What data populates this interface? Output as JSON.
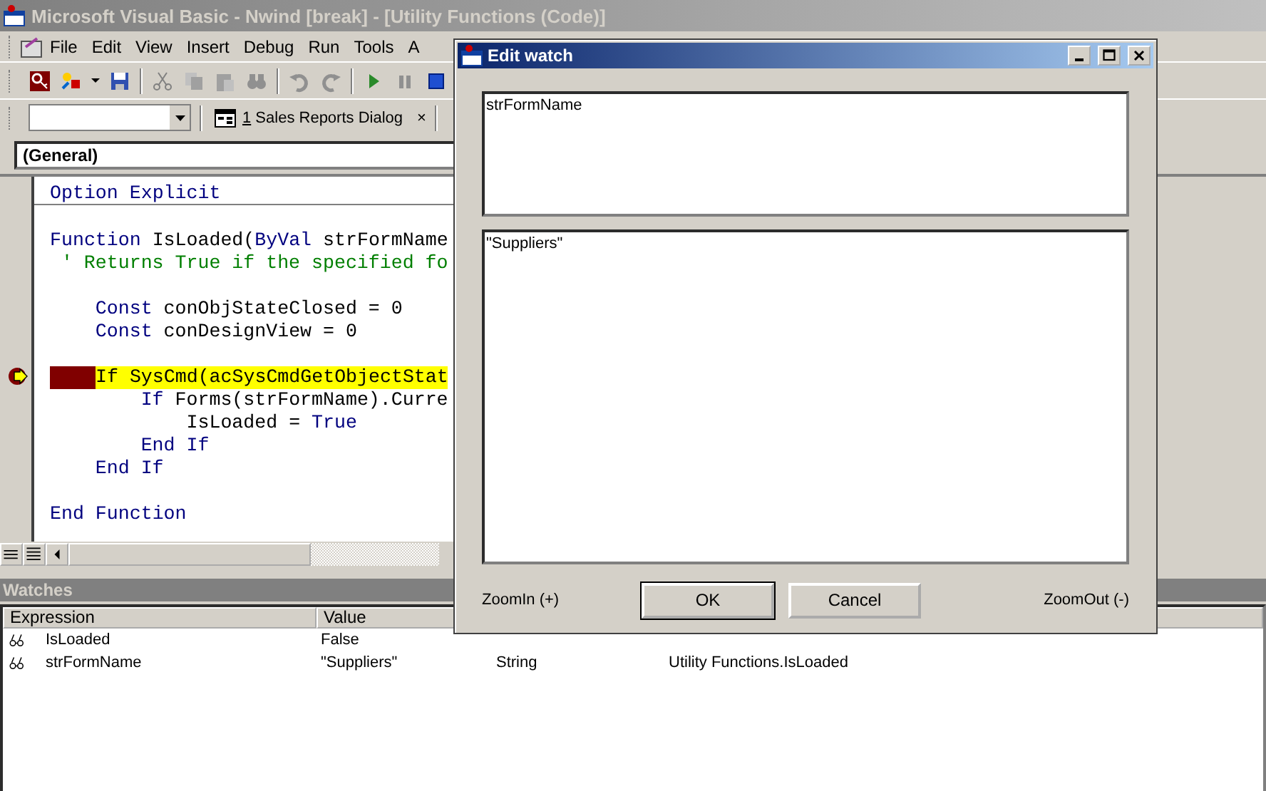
{
  "window": {
    "title": "Microsoft Visual Basic - Nwind [break] - [Utility Functions (Code)]"
  },
  "menu": [
    "File",
    "Edit",
    "View",
    "Insert",
    "Debug",
    "Run",
    "Tools",
    "A"
  ],
  "toolbar2": {
    "tab_number": "1",
    "tab_label": " Sales Reports Dialog",
    "close": "×"
  },
  "object_combo": {
    "value": "(General)"
  },
  "code": [
    {
      "kind": "code",
      "separator": true,
      "current": false,
      "segments": [
        {
          "text": "Option Explicit",
          "kind": "keyword"
        }
      ]
    },
    {
      "kind": "blank"
    },
    {
      "kind": "code",
      "separator": false,
      "current": false,
      "segments": [
        {
          "text": "Function",
          "kind": "keyword"
        },
        {
          "text": " IsLoaded(",
          "kind": "plain"
        },
        {
          "text": "ByVal",
          "kind": "keyword"
        },
        {
          "text": " strFormName",
          "kind": "plain"
        }
      ]
    },
    {
      "kind": "code",
      "separator": false,
      "current": false,
      "segments": [
        {
          "text": " ' Returns True if the specified fo",
          "kind": "comment"
        }
      ]
    },
    {
      "kind": "blank"
    },
    {
      "kind": "code",
      "separator": false,
      "current": false,
      "segments": [
        {
          "text": "    Const",
          "kind": "keyword"
        },
        {
          "text": " conObjStateClosed = 0",
          "kind": "plain"
        }
      ]
    },
    {
      "kind": "code",
      "separator": false,
      "current": false,
      "segments": [
        {
          "text": "    Const",
          "kind": "keyword"
        },
        {
          "text": " conDesignView = 0",
          "kind": "plain"
        }
      ]
    },
    {
      "kind": "blank"
    },
    {
      "kind": "code",
      "separator": false,
      "current": true,
      "segments": [
        {
          "text": "    If SysCmd(acSysCmdGetObjectStat",
          "kind": "plain"
        }
      ]
    },
    {
      "kind": "code",
      "separator": false,
      "current": false,
      "segments": [
        {
          "text": "        If",
          "kind": "keyword"
        },
        {
          "text": " Forms(strFormName).Curre",
          "kind": "plain"
        }
      ]
    },
    {
      "kind": "code",
      "separator": false,
      "current": false,
      "segments": [
        {
          "text": "            IsLoaded = ",
          "kind": "plain"
        },
        {
          "text": "True",
          "kind": "keyword"
        }
      ]
    },
    {
      "kind": "code",
      "separator": false,
      "current": false,
      "segments": [
        {
          "text": "        End If",
          "kind": "keyword"
        }
      ]
    },
    {
      "kind": "code",
      "separator": false,
      "current": false,
      "segments": [
        {
          "text": "    End If",
          "kind": "keyword"
        }
      ]
    },
    {
      "kind": "blank"
    },
    {
      "kind": "code",
      "separator": false,
      "current": false,
      "segments": [
        {
          "text": "End Function",
          "kind": "keyword"
        }
      ]
    }
  ],
  "watches": {
    "title": "Watches",
    "columns": [
      "Expression",
      "Value"
    ],
    "rows": [
      {
        "expression": "IsLoaded",
        "value": "False"
      },
      {
        "expression": "strFormName",
        "value": "\"Suppliers\"",
        "type": "String",
        "context": "Utility Functions.IsLoaded"
      }
    ]
  },
  "dialog": {
    "title": "Edit watch",
    "expression": "strFormName",
    "result": "\"Suppliers\"",
    "zoom_in": "ZoomIn (+)",
    "zoom_out": "ZoomOut (-)",
    "buttons": [
      {
        "label": "OK",
        "default": true
      },
      {
        "label": "Cancel",
        "default": false
      }
    ]
  }
}
